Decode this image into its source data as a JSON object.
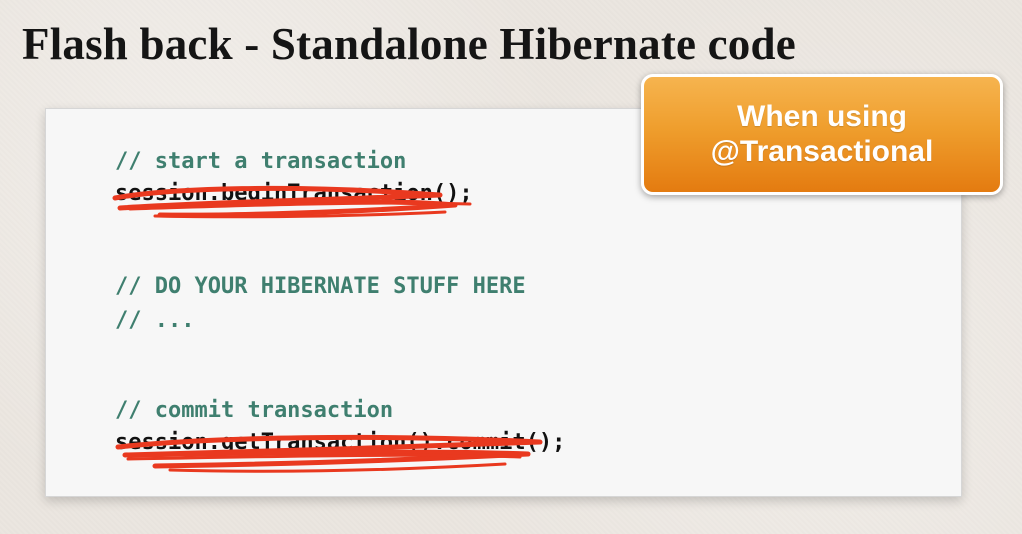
{
  "slide": {
    "title": "Flash back - Standalone Hibernate code"
  },
  "code": {
    "lines": [
      "// start a transaction",
      "session.beginTransaction();",
      "// DO YOUR HIBERNATE STUFF HERE",
      "// ...",
      "// commit transaction",
      "session.getTransaction().commit();"
    ]
  },
  "callout": {
    "line1": "When using",
    "line2": "@Transactional"
  },
  "colors": {
    "comment": "#3f7f6f",
    "code": "#111111",
    "scribble": "#e9391f",
    "callout_top": "#f6b44f",
    "callout_bottom": "#e47b10"
  }
}
